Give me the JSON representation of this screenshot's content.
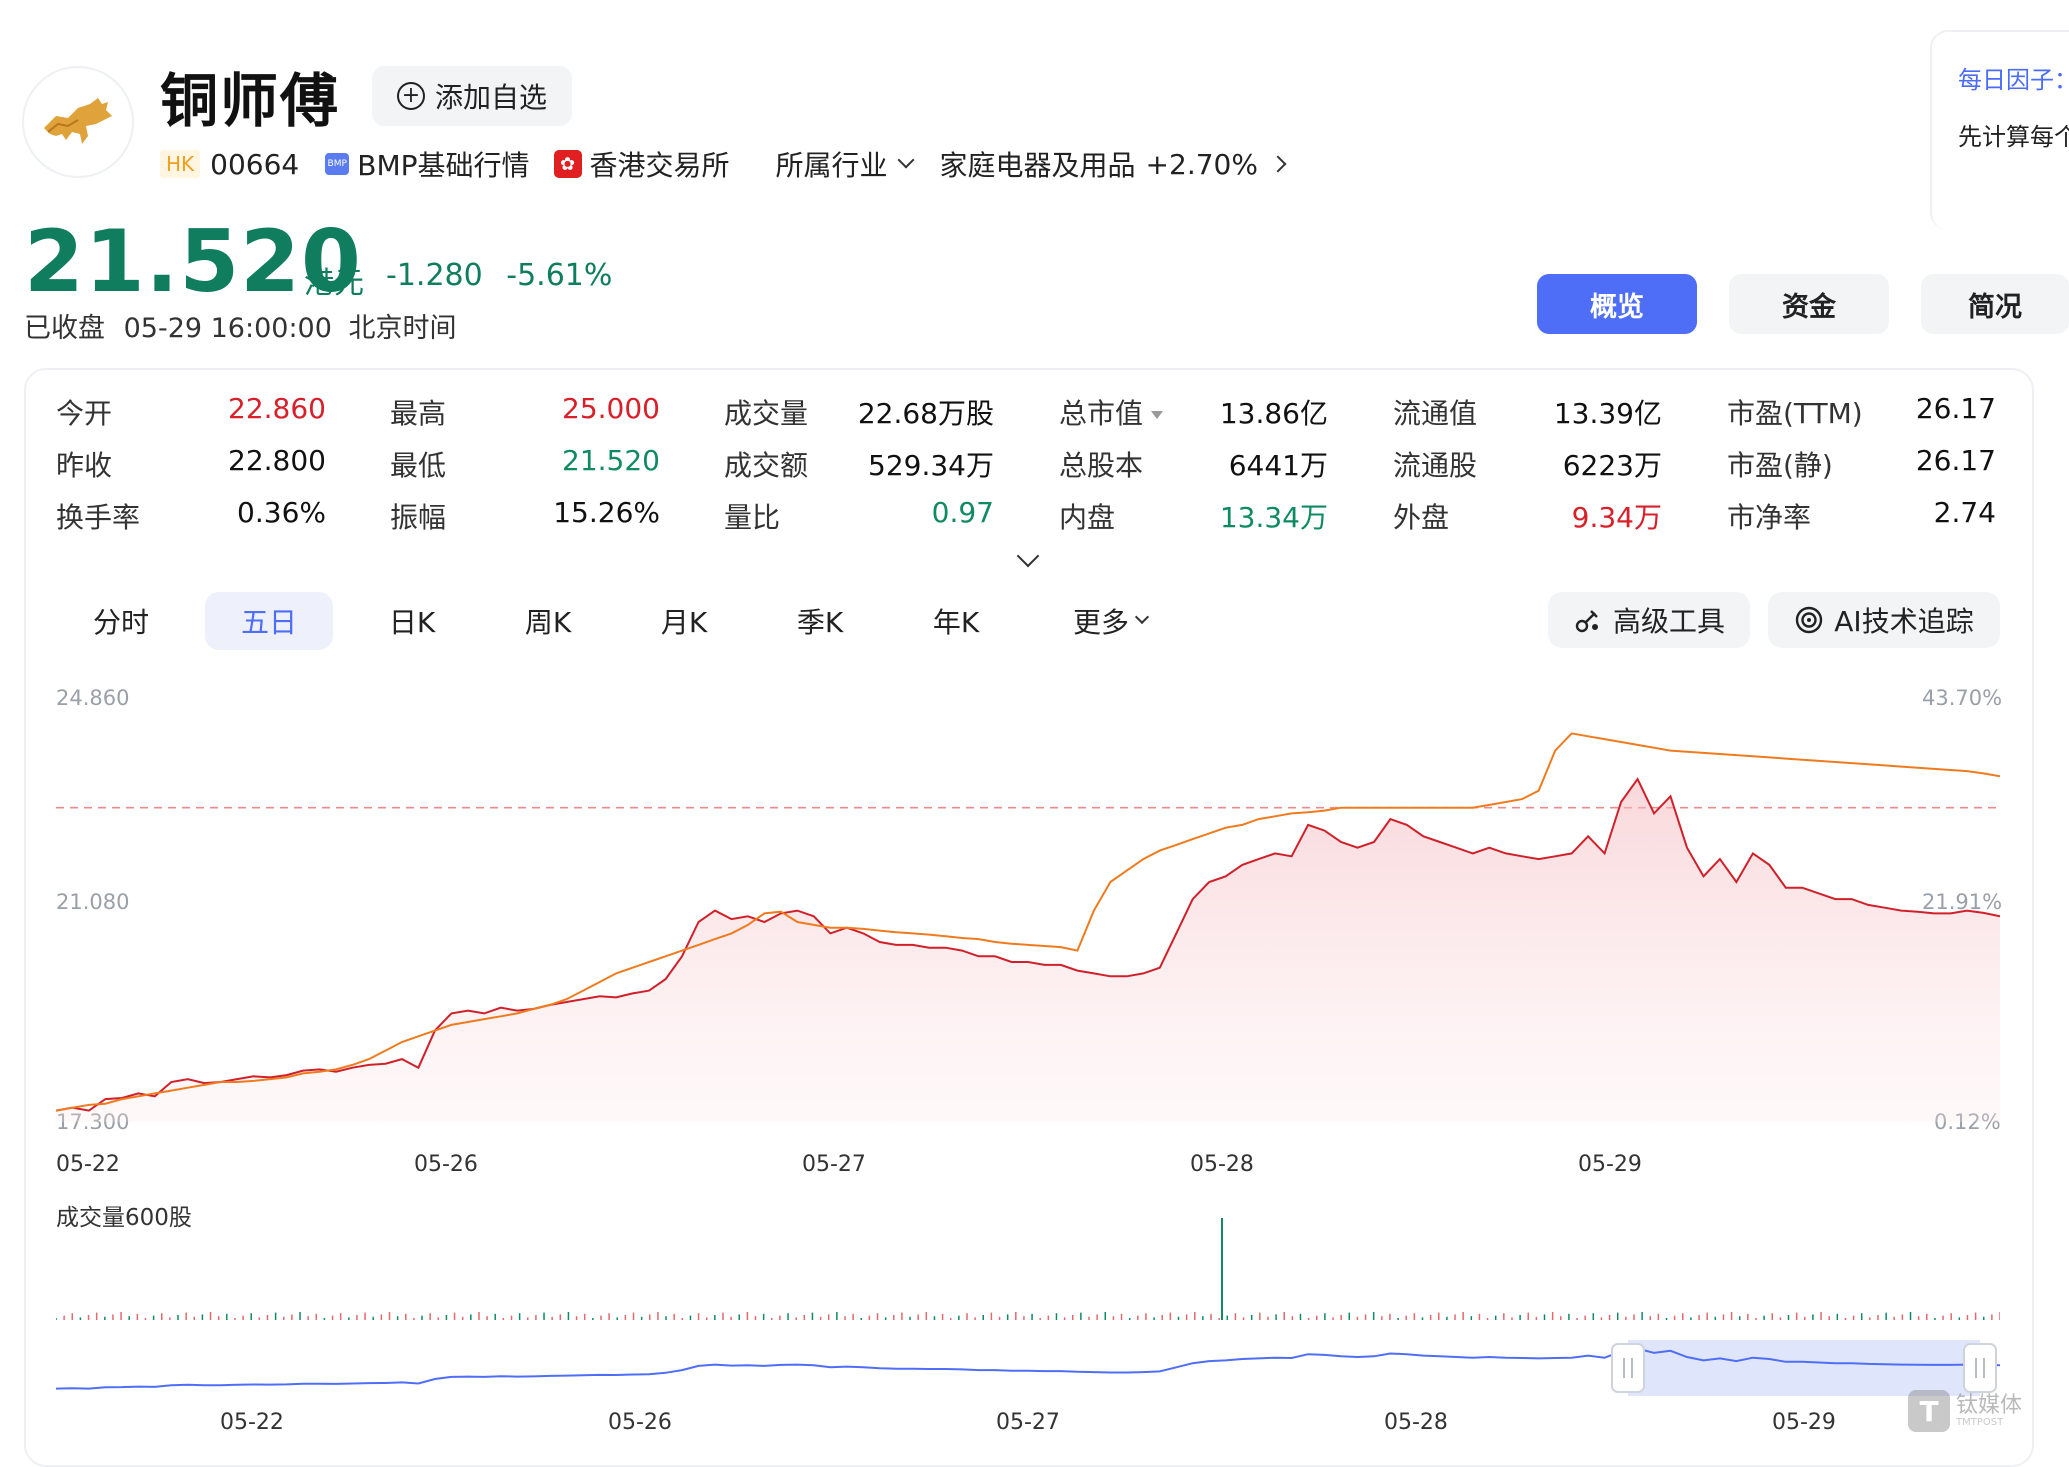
{
  "header": {
    "stock_name": "铜师傅",
    "add_button": "添加自选",
    "market_tag": "HK",
    "code": "00664",
    "bmp_icon": "BMP",
    "bmp_label": "BMP基础行情",
    "exchange": "香港交易所",
    "industry_label": "所属行业",
    "industry_name": "家庭电器及用品",
    "industry_change": "+2.70%"
  },
  "quote": {
    "price": "21.520",
    "unit": "港元",
    "change": "-1.280",
    "change_pct": "-5.61%",
    "status": "已收盘",
    "datetime": "05-29 16:00:00",
    "timezone": "北京时间"
  },
  "factor_card": {
    "title": "每日因子：",
    "text": "先计算每个"
  },
  "top_tabs": [
    "概览",
    "资金",
    "简况"
  ],
  "stats": [
    [
      {
        "label": "今开",
        "value": "22.860",
        "color": "red"
      },
      {
        "label": "最高",
        "value": "25.000",
        "color": "red"
      },
      {
        "label": "成交量",
        "value": "22.68万股",
        "color": ""
      },
      {
        "label": "总市值",
        "value": "13.86亿",
        "color": ""
      },
      {
        "label": "流通值",
        "value": "13.39亿",
        "color": ""
      },
      {
        "label": "市盈(TTM)",
        "value": "26.17",
        "color": ""
      }
    ],
    [
      {
        "label": "昨收",
        "value": "22.800",
        "color": ""
      },
      {
        "label": "最低",
        "value": "21.520",
        "color": "green"
      },
      {
        "label": "成交额",
        "value": "529.34万",
        "color": ""
      },
      {
        "label": "总股本",
        "value": "6441万",
        "color": ""
      },
      {
        "label": "流通股",
        "value": "6223万",
        "color": ""
      },
      {
        "label": "市盈(静)",
        "value": "26.17",
        "color": ""
      }
    ],
    [
      {
        "label": "换手率",
        "value": "0.36%",
        "color": ""
      },
      {
        "label": "振幅",
        "value": "15.26%",
        "color": ""
      },
      {
        "label": "量比",
        "value": "0.97",
        "color": "green"
      },
      {
        "label": "内盘",
        "value": "13.34万",
        "color": "green"
      },
      {
        "label": "外盘",
        "value": "9.34万",
        "color": "red"
      },
      {
        "label": "市净率",
        "value": "2.74",
        "color": ""
      }
    ]
  ],
  "periods": [
    "分时",
    "五日",
    "日K",
    "周K",
    "月K",
    "季K",
    "年K",
    "更多"
  ],
  "active_period": "五日",
  "tools": {
    "advanced": "高级工具",
    "ai_track": "AI技术追踪"
  },
  "chart_data": {
    "type": "line",
    "y_left_ticks": [
      "24.860",
      "21.080",
      "17.300"
    ],
    "y_right_ticks": [
      "43.70%",
      "21.91%",
      "0.12%"
    ],
    "ylim": [
      17.3,
      24.86
    ],
    "prev_close": 22.8,
    "x_dates": [
      "05-22",
      "05-26",
      "05-27",
      "05-28",
      "05-29"
    ],
    "series": [
      {
        "color": "#d0202a",
        "values": [
          17.5,
          17.55,
          17.5,
          17.7,
          17.72,
          17.8,
          17.75,
          18.0,
          18.05,
          17.98,
          18.0,
          18.05,
          18.1,
          18.08,
          18.12,
          18.2,
          18.22,
          18.18,
          18.25,
          18.3,
          18.32,
          18.4,
          18.25,
          18.9,
          19.2,
          19.25,
          19.2,
          19.3,
          19.25,
          19.28,
          19.35,
          19.4,
          19.45,
          19.5,
          19.48,
          19.55,
          19.6,
          19.8,
          20.2,
          20.8,
          21.0,
          20.85,
          20.9,
          20.8,
          20.95,
          21.0,
          20.9,
          20.6,
          20.7,
          20.6,
          20.45,
          20.4,
          20.4,
          20.35,
          20.35,
          20.3,
          20.2,
          20.2,
          20.1,
          20.1,
          20.05,
          20.05,
          19.95,
          19.9,
          19.85,
          19.85,
          19.9,
          20.0,
          20.6,
          21.2,
          21.5,
          21.6,
          21.8,
          21.9,
          22.0,
          21.95,
          22.5,
          22.4,
          22.2,
          22.1,
          22.2,
          22.6,
          22.5,
          22.3,
          22.2,
          22.1,
          22.0,
          22.1,
          22.0,
          21.95,
          21.9,
          21.95,
          22.0,
          22.3,
          22.0,
          22.9,
          23.3,
          22.7,
          23.0,
          22.1,
          21.6,
          21.9,
          21.5,
          22.0,
          21.8,
          21.4,
          21.4,
          21.3,
          21.2,
          21.2,
          21.1,
          21.05,
          21.0,
          20.98,
          20.95,
          20.95,
          21.0,
          20.96,
          20.9
        ]
      },
      {
        "color": "#f07b1e",
        "values": [
          17.5,
          17.55,
          17.6,
          17.62,
          17.7,
          17.75,
          17.8,
          17.85,
          17.9,
          17.95,
          18.0,
          18.0,
          18.02,
          18.05,
          18.08,
          18.15,
          18.18,
          18.22,
          18.3,
          18.4,
          18.55,
          18.7,
          18.8,
          18.9,
          19.0,
          19.05,
          19.1,
          19.15,
          19.2,
          19.28,
          19.35,
          19.45,
          19.6,
          19.75,
          19.9,
          20.0,
          20.1,
          20.2,
          20.3,
          20.4,
          20.5,
          20.6,
          20.75,
          20.95,
          20.98,
          20.8,
          20.75,
          20.7,
          20.7,
          20.68,
          20.65,
          20.62,
          20.6,
          20.58,
          20.55,
          20.52,
          20.5,
          20.45,
          20.42,
          20.4,
          20.38,
          20.36,
          20.3,
          21.0,
          21.5,
          21.7,
          21.9,
          22.05,
          22.15,
          22.25,
          22.35,
          22.45,
          22.5,
          22.6,
          22.65,
          22.7,
          22.72,
          22.75,
          22.8,
          22.8,
          22.8,
          22.8,
          22.8,
          22.8,
          22.8,
          22.8,
          22.8,
          22.85,
          22.9,
          22.95,
          23.1,
          23.8,
          24.1,
          24.05,
          24.0,
          23.95,
          23.9,
          23.85,
          23.8,
          23.78,
          23.76,
          23.74,
          23.72,
          23.7,
          23.68,
          23.66,
          23.64,
          23.62,
          23.6,
          23.58,
          23.56,
          23.54,
          23.52,
          23.5,
          23.48,
          23.46,
          23.44,
          23.4,
          23.35
        ]
      }
    ]
  },
  "volume": {
    "title": "成交量600股"
  },
  "navigator": {
    "dates": [
      "05-22",
      "05-26",
      "05-27",
      "05-28",
      "05-29"
    ]
  },
  "watermark": {
    "logo": "T",
    "text": "钛媒体",
    "sub": "TMTPOST"
  }
}
